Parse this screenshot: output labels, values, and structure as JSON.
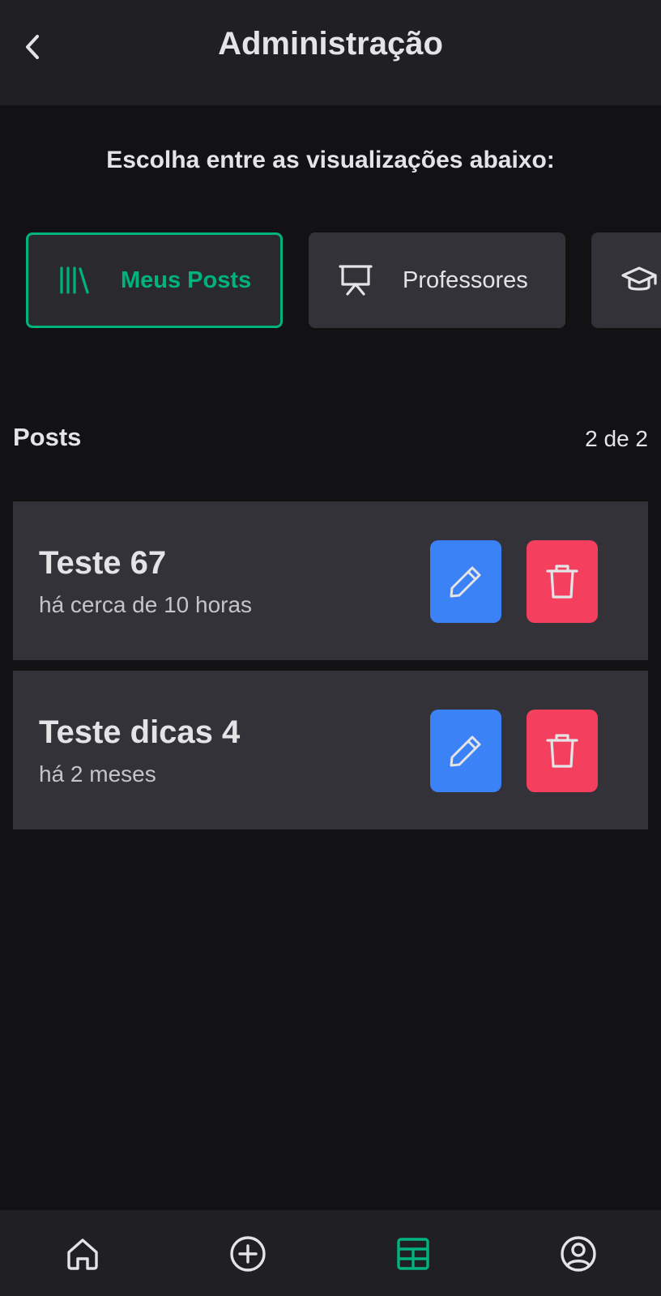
{
  "header": {
    "title": "Administração",
    "back_icon": "chevron-left-icon"
  },
  "subtitle": "Escolha entre as visualizações abaixo:",
  "views": [
    {
      "label": "Meus Posts",
      "icon": "library-icon",
      "active": true
    },
    {
      "label": "Professores",
      "icon": "presentation-icon",
      "active": false
    },
    {
      "label": "",
      "icon": "graduation-cap-icon",
      "active": false
    }
  ],
  "section": {
    "title": "Posts",
    "count": "2 de 2"
  },
  "posts": [
    {
      "title": "Teste 67",
      "time": "há cerca de 10 horas"
    },
    {
      "title": "Teste dicas 4",
      "time": "há 2 meses"
    }
  ],
  "bottom_nav": [
    {
      "icon": "home-icon",
      "active": false
    },
    {
      "icon": "plus-circle-icon",
      "active": false
    },
    {
      "icon": "table-icon",
      "active": true
    },
    {
      "icon": "user-circle-icon",
      "active": false
    }
  ],
  "colors": {
    "background": "#121214",
    "surface": "#202024",
    "card": "#323238",
    "accent": "#00b37e",
    "edit": "#3b82f6",
    "delete": "#f43f5e",
    "text": "#e4e4e7"
  }
}
